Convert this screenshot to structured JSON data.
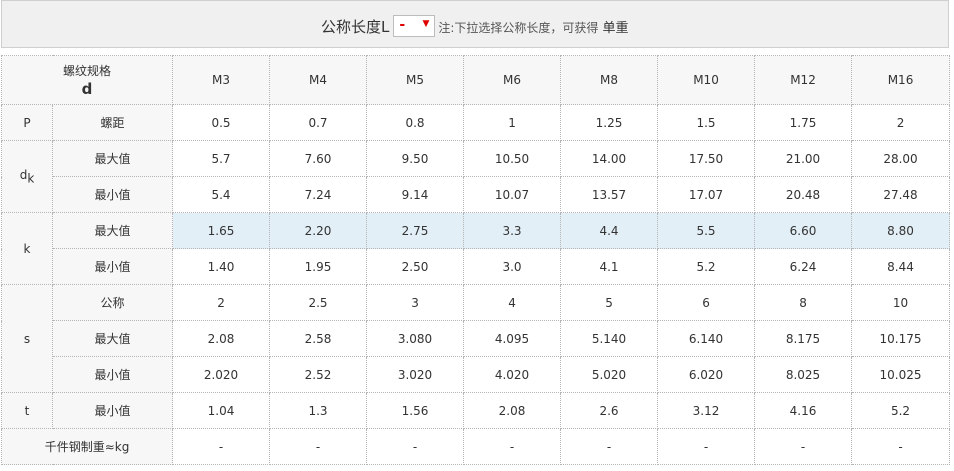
{
  "header": {
    "length_label": "公称长度L",
    "length_value": "-",
    "caret": "▼",
    "note_prefix": "注:下拉选择公称长度，可获得",
    "note_emphasis": " 单重",
    "colors": {
      "accent": "#e00000",
      "highlight_row": "#e3eff7",
      "header_bg": "#f0f0f0"
    }
  },
  "table": {
    "corner_top": "螺纹规格",
    "corner_bottom": "d",
    "sizes": [
      "M3",
      "M4",
      "M5",
      "M6",
      "M8",
      "M10",
      "M12",
      "M16"
    ],
    "rows": [
      {
        "symbol": "P",
        "symbol_sub": "",
        "label": "螺距",
        "highlight": false,
        "values": [
          "0.5",
          "0.7",
          "0.8",
          "1",
          "1.25",
          "1.5",
          "1.75",
          "2"
        ]
      },
      {
        "symbol": "d",
        "symbol_sub": "k",
        "label": "最大值",
        "highlight": false,
        "values": [
          "5.7",
          "7.60",
          "9.50",
          "10.50",
          "14.00",
          "17.50",
          "21.00",
          "28.00"
        ]
      },
      {
        "symbol": "",
        "symbol_sub": "",
        "label": "最小值",
        "highlight": false,
        "values": [
          "5.4",
          "7.24",
          "9.14",
          "10.07",
          "13.57",
          "17.07",
          "20.48",
          "27.48"
        ]
      },
      {
        "symbol": "k",
        "symbol_sub": "",
        "label": "最大值",
        "highlight": true,
        "values": [
          "1.65",
          "2.20",
          "2.75",
          "3.3",
          "4.4",
          "5.5",
          "6.60",
          "8.80"
        ]
      },
      {
        "symbol": "",
        "symbol_sub": "",
        "label": "最小值",
        "highlight": false,
        "values": [
          "1.40",
          "1.95",
          "2.50",
          "3.0",
          "4.1",
          "5.2",
          "6.24",
          "8.44"
        ]
      },
      {
        "symbol": "s",
        "symbol_sub": "",
        "label": "公称",
        "highlight": false,
        "values": [
          "2",
          "2.5",
          "3",
          "4",
          "5",
          "6",
          "8",
          "10"
        ]
      },
      {
        "symbol": "",
        "symbol_sub": "",
        "label": "最大值",
        "highlight": false,
        "values": [
          "2.08",
          "2.58",
          "3.080",
          "4.095",
          "5.140",
          "6.140",
          "8.175",
          "10.175"
        ]
      },
      {
        "symbol": "",
        "symbol_sub": "",
        "label": "最小值",
        "highlight": false,
        "values": [
          "2.020",
          "2.52",
          "3.020",
          "4.020",
          "5.020",
          "6.020",
          "8.025",
          "10.025"
        ]
      },
      {
        "symbol": "t",
        "symbol_sub": "",
        "label": "最小值",
        "highlight": false,
        "values": [
          "1.04",
          "1.3",
          "1.56",
          "2.08",
          "2.6",
          "3.12",
          "4.16",
          "5.2"
        ]
      }
    ],
    "weight_label": "千件钢制重≈kg",
    "weights": [
      "-",
      "-",
      "-",
      "-",
      "-",
      "-",
      "-",
      "-"
    ]
  }
}
